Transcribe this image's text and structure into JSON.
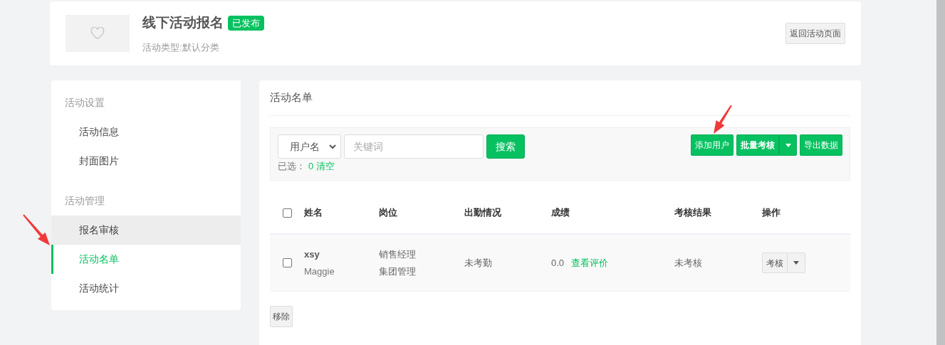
{
  "header": {
    "title": "线下活动报名",
    "status_badge": "已发布",
    "subtitle": "活动类型:默认分类",
    "back_button": "返回活动页面"
  },
  "sidebar": {
    "sections": [
      {
        "heading": "活动设置",
        "items": [
          {
            "label": "活动信息",
            "selected": false,
            "hovered": false
          },
          {
            "label": "封面图片",
            "selected": false,
            "hovered": false
          }
        ]
      },
      {
        "heading": "活动管理",
        "items": [
          {
            "label": "报名审核",
            "selected": false,
            "hovered": true
          },
          {
            "label": "活动名单",
            "selected": true,
            "hovered": false
          },
          {
            "label": "活动统计",
            "selected": false,
            "hovered": false
          }
        ]
      }
    ]
  },
  "panel": {
    "title": "活动名单",
    "filter": {
      "field_select": "用户名",
      "keyword": {
        "placeholder": "关键词"
      },
      "search_button": "搜索",
      "selected_label": "已选：",
      "selected_count": "0",
      "clear_link": "清空"
    },
    "actions": {
      "add_user": "添加用户",
      "batch_review": "批量考核",
      "export": "导出数据"
    },
    "table": {
      "select_all_checked": false,
      "columns": [
        "姓名",
        "岗位",
        "出勤情况",
        "成绩",
        "考核结果",
        "操作"
      ],
      "rows": [
        {
          "checked": false,
          "username": "xsy",
          "name": "Maggie",
          "positions": [
            "销售经理",
            "集团管理"
          ],
          "attendance": "未考勤",
          "score": "0.0",
          "review_link": "查看评价",
          "result": "未考核",
          "action_button": "考核"
        }
      ]
    },
    "remove_button": "移除"
  }
}
